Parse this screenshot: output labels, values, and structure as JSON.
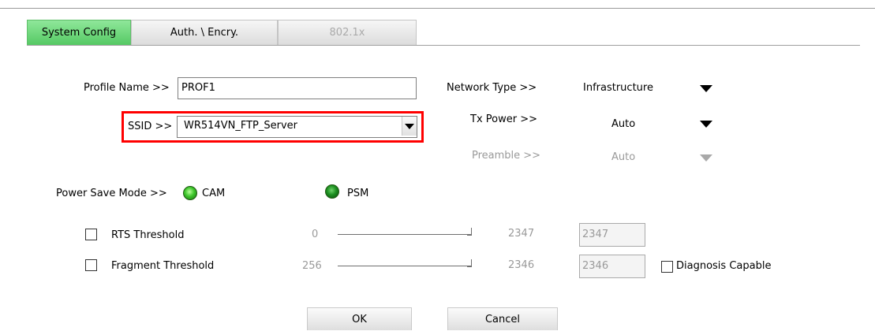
{
  "tabs": [
    {
      "label": "System Config",
      "state": "active"
    },
    {
      "label": "Auth. \\ Encry.",
      "state": "normal"
    },
    {
      "label": "802.1x",
      "state": "disabled"
    }
  ],
  "profile": {
    "label": "Profile Name >>",
    "value": "PROF1"
  },
  "ssid": {
    "label": "SSID >>",
    "value": "WR514VN_FTP_Server"
  },
  "network_type": {
    "label": "Network Type >>",
    "value": "Infrastructure"
  },
  "tx_power": {
    "label": "Tx Power >>",
    "value": "Auto"
  },
  "preamble": {
    "label": "Preamble >>",
    "value": "Auto"
  },
  "power_save": {
    "label": "Power Save Mode >>",
    "options": [
      {
        "label": "CAM",
        "selected": true
      },
      {
        "label": "PSM",
        "selected": false
      }
    ]
  },
  "rts": {
    "label": "RTS Threshold",
    "checked": false,
    "min": "0",
    "max": "2347",
    "value": "2347"
  },
  "fragment": {
    "label": "Fragment Threshold",
    "checked": false,
    "min": "256",
    "max": "2346",
    "value": "2346"
  },
  "diagnosis": {
    "label": "Diagnosis Capable",
    "checked": false
  },
  "buttons": {
    "ok": "OK",
    "cancel": "Cancel"
  },
  "colors": {
    "highlight_border": "#ff0000",
    "active_tab": "#55c964"
  }
}
